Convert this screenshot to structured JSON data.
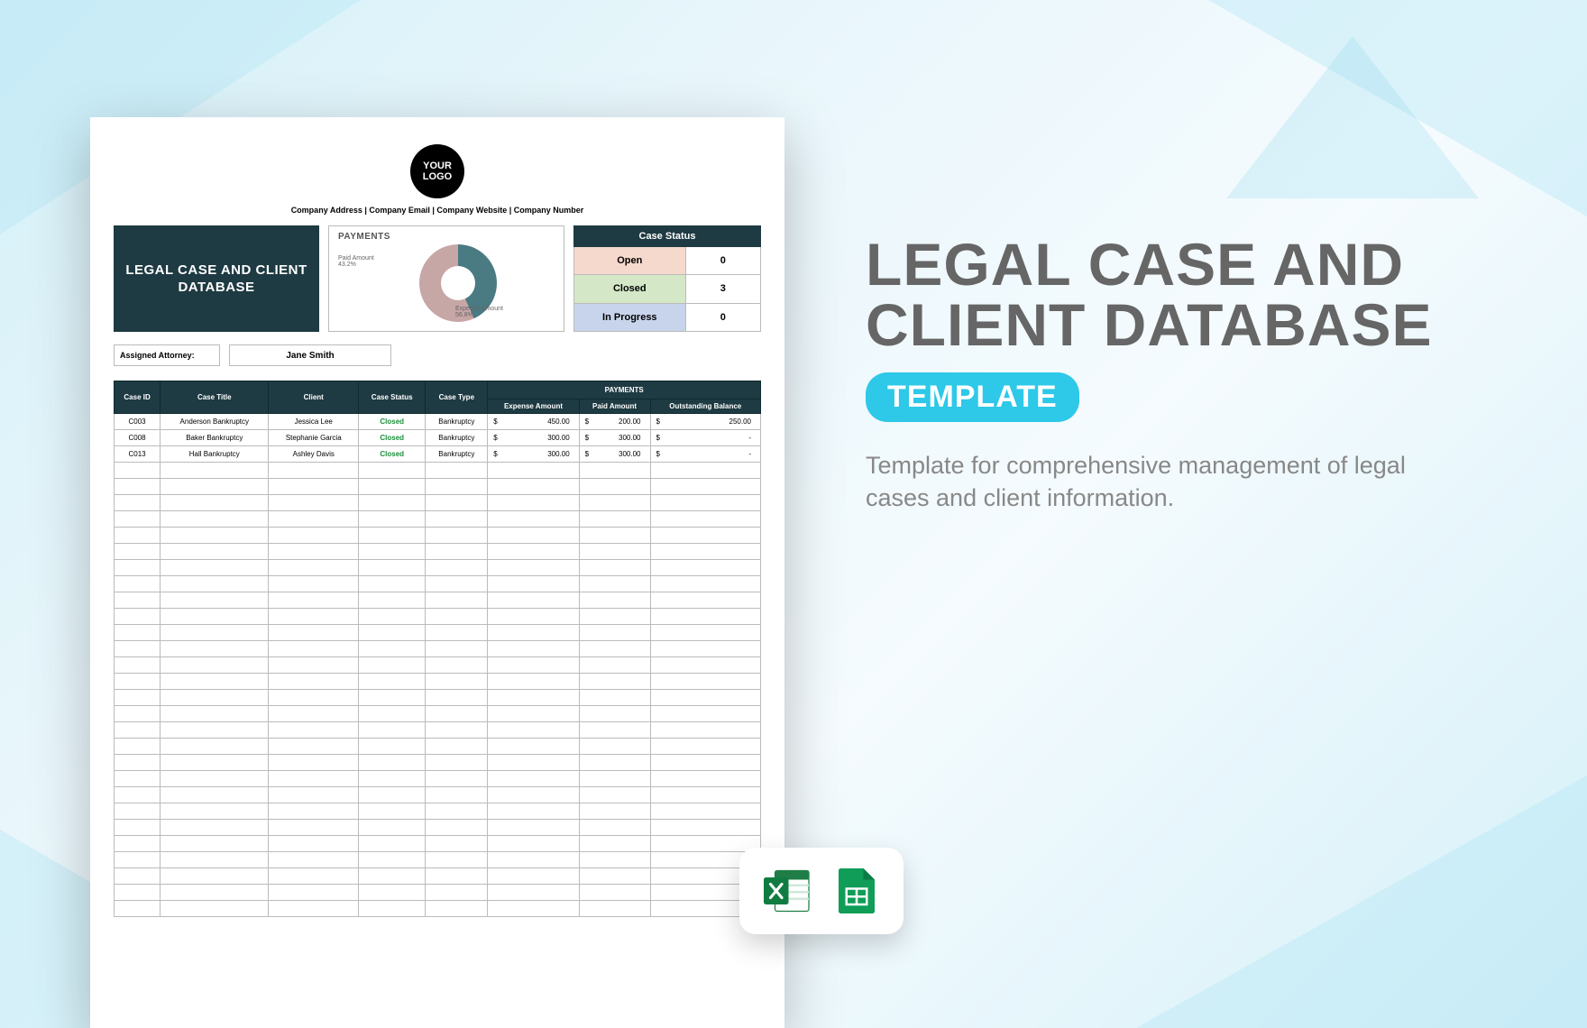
{
  "page": {
    "logo_text": "YOUR LOGO",
    "company_line": "Company Address | Company Email | Company Website | Company Number",
    "title": "LEGAL CASE AND CLIENT DATABASE",
    "payments_title": "PAYMENTS",
    "donut_label_paid": "Paid Amount",
    "donut_pct_paid": "43.2%",
    "donut_label_exp": "Expense Amount",
    "donut_pct_exp": "56.8%",
    "status_header": "Case Status",
    "status_open_label": "Open",
    "status_open_val": "0",
    "status_closed_label": "Closed",
    "status_closed_val": "3",
    "status_prog_label": "In Progress",
    "status_prog_val": "0",
    "attorney_label": "Assigned Attorney:",
    "attorney_name": "Jane Smith",
    "col_case_id": "Case ID",
    "col_case_title": "Case Title",
    "col_client": "Client",
    "col_case_status": "Case Status",
    "col_case_type": "Case Type",
    "col_payments": "PAYMENTS",
    "col_expense": "Expense Amount",
    "col_paid": "Paid Amount",
    "col_balance": "Outstanding Balance",
    "rows": [
      {
        "id": "C003",
        "title": "Anderson Bankruptcy",
        "client": "Jessica Lee",
        "status": "Closed",
        "type": "Bankruptcy",
        "exp": "450.00",
        "paid": "200.00",
        "bal": "250.00"
      },
      {
        "id": "C008",
        "title": "Baker Bankruptcy",
        "client": "Stephanie Garcia",
        "status": "Closed",
        "type": "Bankruptcy",
        "exp": "300.00",
        "paid": "300.00",
        "bal": "-"
      },
      {
        "id": "C013",
        "title": "Hall Bankruptcy",
        "client": "Ashley Davis",
        "status": "Closed",
        "type": "Bankruptcy",
        "exp": "300.00",
        "paid": "300.00",
        "bal": "-"
      }
    ]
  },
  "marketing": {
    "title": "LEGAL CASE AND CLIENT DATABASE",
    "badge": "TEMPLATE",
    "desc": "Template for comprehensive management of legal cases and client information."
  },
  "chart_data": {
    "type": "pie",
    "title": "PAYMENTS",
    "series": [
      {
        "name": "Paid Amount",
        "value": 43.2,
        "color": "#4a7a82"
      },
      {
        "name": "Expense Amount",
        "value": 56.8,
        "color": "#c7a6a6"
      }
    ]
  }
}
